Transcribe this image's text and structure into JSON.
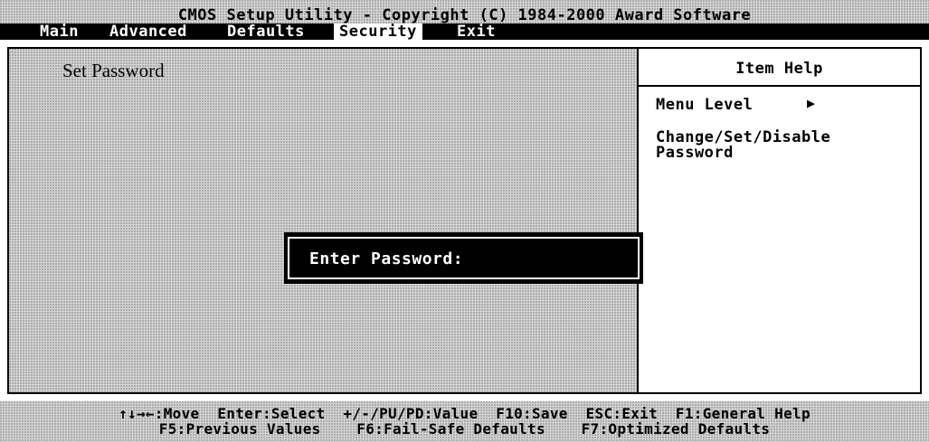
{
  "title": "CMOS Setup Utility - Copyright (C) 1984-2000 Award Software",
  "menu": {
    "items": [
      {
        "label": "Main"
      },
      {
        "label": "Advanced"
      },
      {
        "label": "Defaults"
      },
      {
        "label": "Security",
        "active": true
      },
      {
        "label": "Exit"
      }
    ]
  },
  "main": {
    "item_label": "Set Password"
  },
  "help": {
    "title": "Item Help",
    "menu_level_label": "Menu Level",
    "menu_level_arrow_icon": "right-triangle-icon",
    "description": "Change/Set/Disable Password"
  },
  "dialog": {
    "label": "Enter Password:",
    "value": ""
  },
  "status": {
    "line1": "↑↓→←:Move  Enter:Select  +/-/PU/PD:Value  F10:Save  ESC:Exit  F1:General Help",
    "line2": "F5:Previous Values    F6:Fail-Safe Defaults    F7:Optimized Defaults"
  },
  "colors": {
    "background": "#d6d6d6",
    "menu_bar": "#000000",
    "active_tab": "#ffffff",
    "dialog_bg": "#000000",
    "dialog_text": "#ffffff"
  }
}
